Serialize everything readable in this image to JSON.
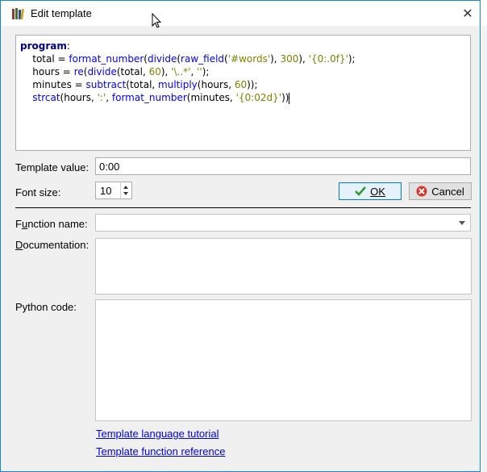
{
  "window": {
    "title": "Edit template",
    "close_glyph": "✕",
    "app_icon": "calibre-books-icon"
  },
  "editor": {
    "lines": [
      [
        {
          "t": "program",
          "c": "kw"
        },
        {
          "t": ":",
          "c": "plain"
        }
      ],
      [
        {
          "t": "    total = ",
          "c": "plain"
        },
        {
          "t": "format_number",
          "c": "fn"
        },
        {
          "t": "(",
          "c": "plain"
        },
        {
          "t": "divide",
          "c": "fn"
        },
        {
          "t": "(",
          "c": "plain"
        },
        {
          "t": "raw_field",
          "c": "fn"
        },
        {
          "t": "(",
          "c": "plain"
        },
        {
          "t": "'#words'",
          "c": "str"
        },
        {
          "t": "), ",
          "c": "plain"
        },
        {
          "t": "300",
          "c": "num"
        },
        {
          "t": "), ",
          "c": "plain"
        },
        {
          "t": "'{0:.0f}'",
          "c": "str"
        },
        {
          "t": ");",
          "c": "plain"
        }
      ],
      [
        {
          "t": "    hours = ",
          "c": "plain"
        },
        {
          "t": "re",
          "c": "fn"
        },
        {
          "t": "(",
          "c": "plain"
        },
        {
          "t": "divide",
          "c": "fn"
        },
        {
          "t": "(total, ",
          "c": "plain"
        },
        {
          "t": "60",
          "c": "num"
        },
        {
          "t": "), ",
          "c": "plain"
        },
        {
          "t": "'\\..*'",
          "c": "str"
        },
        {
          "t": ", ",
          "c": "plain"
        },
        {
          "t": "''",
          "c": "str"
        },
        {
          "t": ");",
          "c": "plain"
        }
      ],
      [
        {
          "t": "    minutes = ",
          "c": "plain"
        },
        {
          "t": "subtract",
          "c": "fn"
        },
        {
          "t": "(total, ",
          "c": "plain"
        },
        {
          "t": "multiply",
          "c": "fn"
        },
        {
          "t": "(hours, ",
          "c": "plain"
        },
        {
          "t": "60",
          "c": "num"
        },
        {
          "t": "));",
          "c": "plain"
        }
      ],
      [
        {
          "t": "    strcat",
          "c": "fn"
        },
        {
          "t": "(hours, ",
          "c": "plain"
        },
        {
          "t": "':'",
          "c": "str"
        },
        {
          "t": ", ",
          "c": "plain"
        },
        {
          "t": "format_number",
          "c": "fn"
        },
        {
          "t": "(minutes, ",
          "c": "plain"
        },
        {
          "t": "'{0:02d}'",
          "c": "str"
        },
        {
          "t": "))",
          "c": "plain"
        }
      ]
    ]
  },
  "template_value": {
    "label": "Template value:",
    "value": "0:00"
  },
  "font_size": {
    "label": "Font size:",
    "value": "10"
  },
  "buttons": {
    "ok_label": "OK",
    "cancel_label": "Cancel"
  },
  "function_name": {
    "label_pre": "F",
    "label_u": "u",
    "label_post": "nction name:",
    "value": ""
  },
  "documentation": {
    "label_u": "D",
    "label_post": "ocumentation:"
  },
  "python_code": {
    "label": "Python code:"
  },
  "links": {
    "tutorial": "Template language tutorial",
    "reference": "Template function reference"
  },
  "colors": {
    "accent": "#1883d7",
    "keyword": "#000080",
    "function": "#0000ff",
    "string": "#808000",
    "link": "#0000ee"
  }
}
